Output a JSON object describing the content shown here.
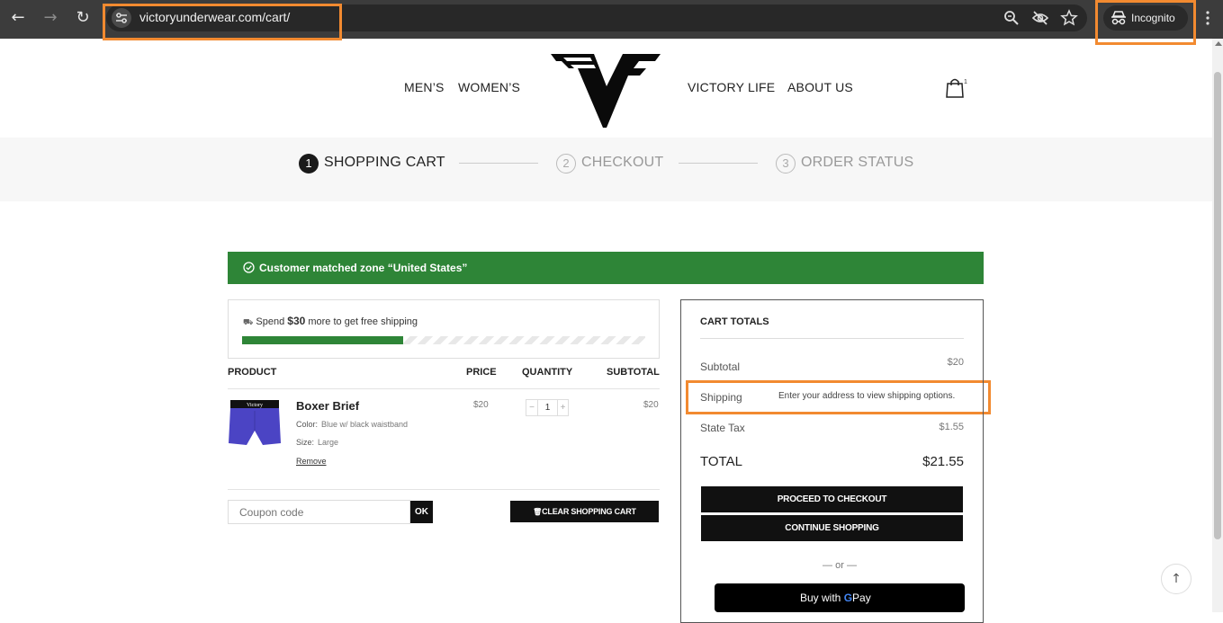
{
  "browser": {
    "url": "victoryunderwear.com/cart/",
    "profile_label": "Incognito"
  },
  "site": {
    "menu_left": [
      "MEN’S",
      "WOMEN’S"
    ],
    "menu_right": [
      "VICTORY LIFE",
      "ABOUT US"
    ],
    "cart_count": "1"
  },
  "steps": [
    {
      "num": "1",
      "label": "SHOPPING CART"
    },
    {
      "num": "2",
      "label": "CHECKOUT"
    },
    {
      "num": "3",
      "label": "ORDER STATUS"
    }
  ],
  "notice": "Customer matched zone “United States”",
  "free_shipping": {
    "prefix": "Spend",
    "amount": "$30",
    "suffix": "more to get free shipping",
    "progress_fraction": 0.4
  },
  "table": {
    "headers": [
      "PRODUCT",
      "PRICE",
      "QUANTITY",
      "SUBTOTAL"
    ],
    "item": {
      "name": "Boxer Brief",
      "color_label": "Color:",
      "color_value": "Blue w/ black waistband",
      "size_label": "Size:",
      "size_value": "Large",
      "remove": "Remove",
      "price": "$20",
      "qty_minus": "−",
      "qty": "1",
      "qty_plus": "+",
      "subtotal": "$20",
      "waistband_text": "Victory"
    }
  },
  "coupon": {
    "placeholder": "Coupon code",
    "apply": "OK",
    "clear": "CLEAR SHOPPING CART"
  },
  "totals": {
    "title": "CART TOTALS",
    "subtotal_label": "Subtotal",
    "subtotal_value": "$20",
    "shipping_label": "Shipping",
    "shipping_note": "Enter your address to view shipping options.",
    "tax_label": "State Tax",
    "tax_value": "$1.55",
    "total_label": "TOTAL",
    "total_value": "$21.55",
    "checkout": "PROCEED TO CHECKOUT",
    "continue": "CONTINUE SHOPPING",
    "or": "— or —",
    "gpay_prefix": "Buy with",
    "gpay_g": "G",
    "gpay_suffix": "Pay"
  },
  "colors": {
    "notice_green": "#2e8537",
    "highlight_orange": "#f28a30",
    "button_black": "#111111"
  },
  "back_to_top": "↑"
}
